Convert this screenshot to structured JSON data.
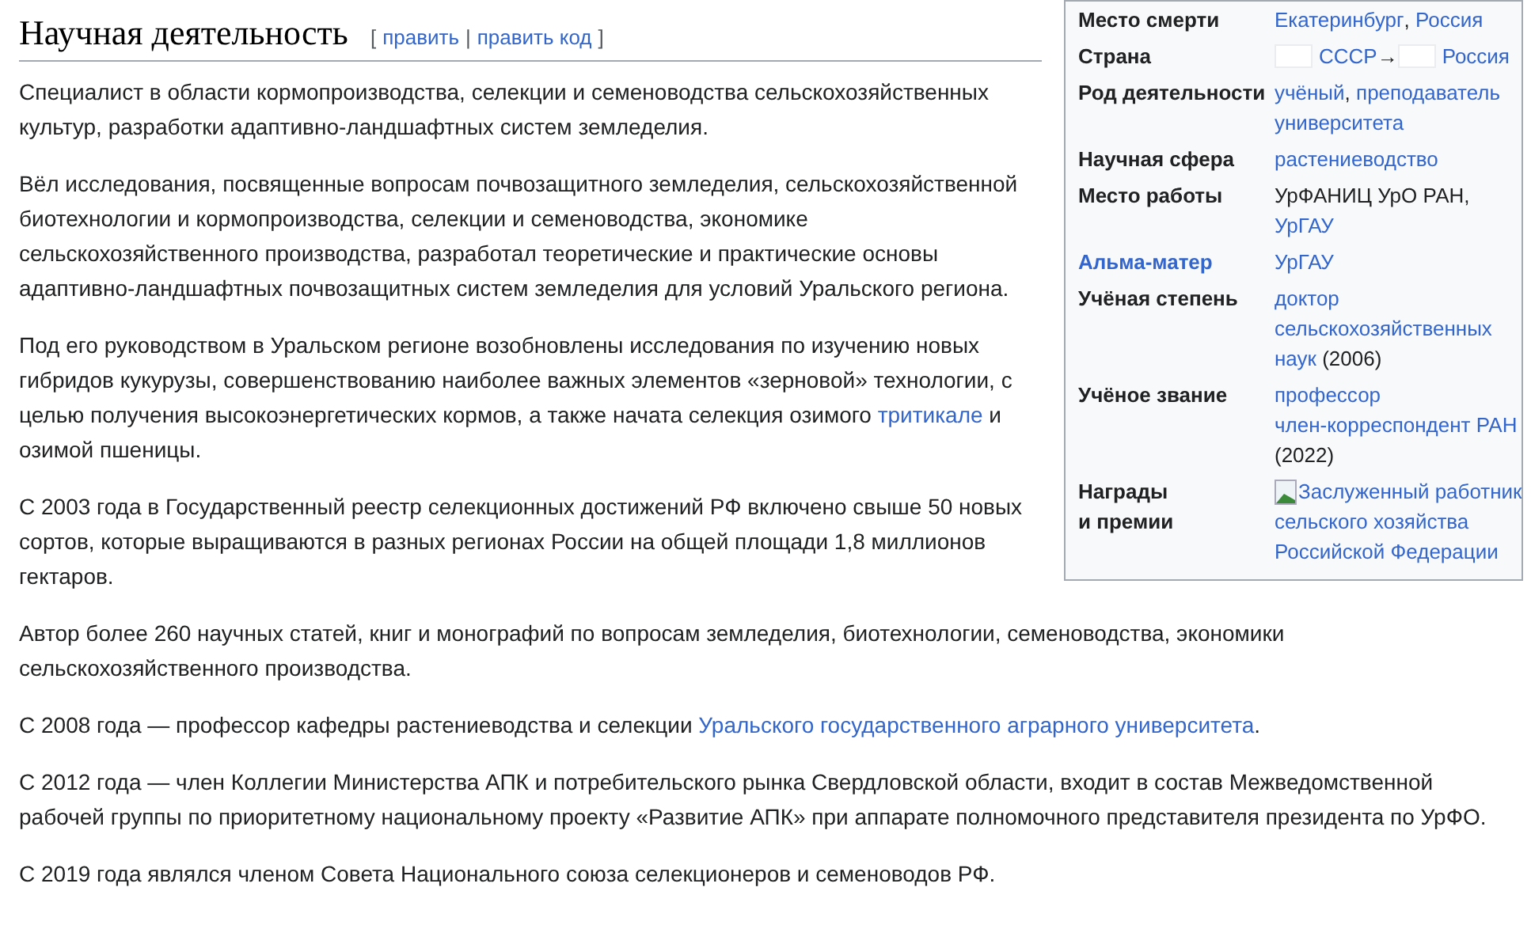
{
  "infobox": {
    "rows": [
      {
        "label": [
          "Место смерти"
        ],
        "label_link": false,
        "value": [
          [
            {
              "kind": "link",
              "text": "Екатеринбург"
            },
            {
              "kind": "text",
              "text": ", "
            },
            {
              "kind": "link",
              "text": "Россия"
            }
          ]
        ]
      },
      {
        "label": [
          "Страна"
        ],
        "label_link": false,
        "value": [
          [
            {
              "kind": "flag"
            },
            {
              "kind": "link",
              "text": "СССР"
            },
            {
              "kind": "text",
              "text": "→"
            },
            {
              "kind": "flag"
            },
            {
              "kind": "link",
              "text": "Россия"
            }
          ]
        ]
      },
      {
        "label": [
          "Род деятельности"
        ],
        "label_link": false,
        "value": [
          [
            {
              "kind": "link",
              "text": "учёный"
            },
            {
              "kind": "text",
              "text": ", "
            },
            {
              "kind": "link",
              "text": "преподаватель"
            }
          ],
          [
            {
              "kind": "link",
              "text": "университета"
            }
          ]
        ]
      },
      {
        "label": [
          "Научная сфера"
        ],
        "label_link": false,
        "value": [
          [
            {
              "kind": "link",
              "text": "растениеводство"
            }
          ]
        ]
      },
      {
        "label": [
          "Место работы"
        ],
        "label_link": false,
        "value": [
          [
            {
              "kind": "text",
              "text": "УрФАНИЦ УрО РАН,"
            }
          ],
          [
            {
              "kind": "link",
              "text": "УрГАУ"
            }
          ]
        ]
      },
      {
        "label": [
          "Альма-матер"
        ],
        "label_link": true,
        "value": [
          [
            {
              "kind": "link",
              "text": "УрГАУ"
            }
          ]
        ]
      },
      {
        "label": [
          "Учёная степень"
        ],
        "label_link": false,
        "value": [
          [
            {
              "kind": "link",
              "text": "доктор"
            }
          ],
          [
            {
              "kind": "link",
              "text": "сельскохозяйственных"
            }
          ],
          [
            {
              "kind": "link",
              "text": "наук"
            },
            {
              "kind": "text",
              "text": " (2006)"
            }
          ]
        ]
      },
      {
        "label": [
          "Учёное звание"
        ],
        "label_link": false,
        "value": [
          [
            {
              "kind": "link",
              "text": "профессор"
            }
          ],
          [
            {
              "kind": "link",
              "text": "член-корреспондент РАН"
            }
          ],
          [
            {
              "kind": "text",
              "text": "(2022)"
            }
          ]
        ]
      },
      {
        "label": [
          "Награды",
          "и премии"
        ],
        "label_link": false,
        "value": [
          [
            {
              "kind": "image"
            },
            {
              "kind": "link",
              "text": "Заслуженный работник"
            }
          ],
          [
            {
              "kind": "link",
              "text": "сельского хозяйства"
            }
          ],
          [
            {
              "kind": "link",
              "text": "Российской Федерации"
            }
          ]
        ]
      }
    ]
  },
  "heading": {
    "title": "Научная деятельность",
    "edit_links": {
      "open": "[",
      "items": [
        "править",
        "править код"
      ],
      "separator": "|",
      "close": "]"
    }
  },
  "paragraphs": [
    [
      {
        "kind": "text",
        "text": "Специалист в области кормопроизводства, селекции и семеноводства сельскохозяйственных культур, разработки адаптивно-ландшафтных систем земледелия."
      }
    ],
    [
      {
        "kind": "text",
        "text": "Вёл исследования, посвященные вопросам почвозащитного земледелия, сельскохозяйственной биотехнологии и кормопроизводства, селекции и семеноводства, экономике сельскохозяйственного производства, разработал теоретические и практические основы адаптивно-ландшафтных почвозащитных систем земледелия для условий Уральского региона."
      }
    ],
    [
      {
        "kind": "text",
        "text": "Под его руководством в Уральском регионе возобновлены исследования по изучению новых гибридов кукурузы, совершенствованию наиболее важных элементов «зерновой» технологии, с целью получения высокоэнергетических кормов, а также начата селекция озимого "
      },
      {
        "kind": "link",
        "text": "тритикале"
      },
      {
        "kind": "text",
        "text": " и озимой пшеницы."
      }
    ],
    [
      {
        "kind": "text",
        "text": "С 2003 года в Государственный реестр селекционных достижений РФ включено свыше 50 новых сортов, которые выращиваются в разных регионах России на общей площади 1,8 миллионов гектаров."
      }
    ],
    [
      {
        "kind": "text",
        "text": "Автор более 260 научных статей, книг и монографий по вопросам земледелия, биотехнологии, семеноводства, экономики сельскохозяйственного производства."
      }
    ],
    [
      {
        "kind": "text",
        "text": "С 2008 года — профессор кафедры растениеводства и селекции "
      },
      {
        "kind": "link",
        "text": "Уральского государственного аграрного университета"
      },
      {
        "kind": "text",
        "text": "."
      }
    ],
    [
      {
        "kind": "text",
        "text": "С 2012 года — член Коллегии Министерства АПК и потребительского рынка Свердловской области, входит в состав Межведомственной рабочей группы по приоритетному национальному проекту «Развитие АПК» при аппарате полномочного представителя президента по УрФО."
      }
    ],
    [
      {
        "kind": "text",
        "text": "С 2019 года являлся членом Совета Национального союза селекционеров и семеноводов РФ."
      }
    ]
  ]
}
